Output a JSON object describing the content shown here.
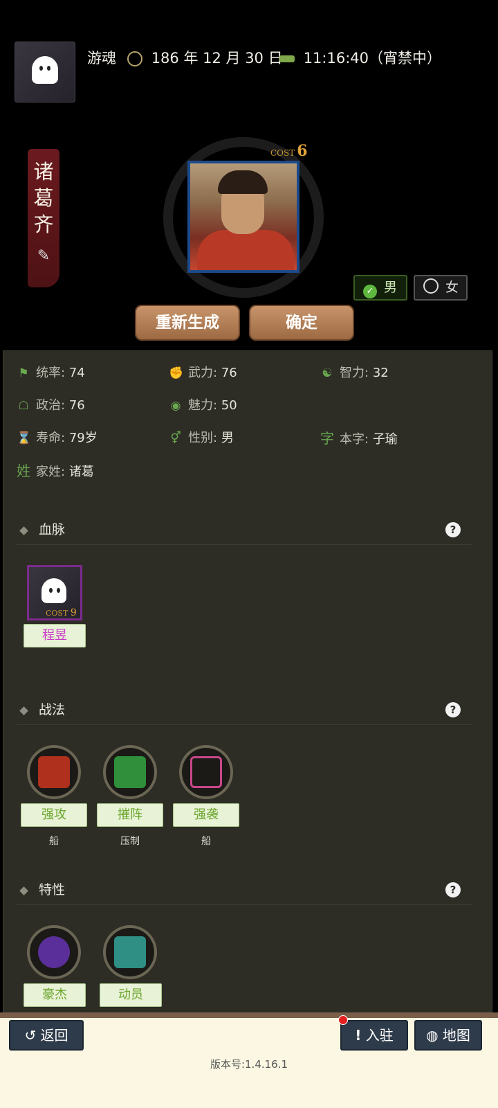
{
  "header": {
    "user": "游魂",
    "date": "186 年 12 月 30 日",
    "time": "11:16:40（宵禁中）"
  },
  "character": {
    "name_chars": [
      "诸",
      "葛",
      "齐"
    ],
    "cost_label": "COST",
    "cost": "6",
    "gender_options": {
      "male": "男",
      "female": "女",
      "selected": "男"
    },
    "regen_label": "重新生成",
    "confirm_label": "确定"
  },
  "stats": {
    "command": {
      "label": "统率:",
      "value": "74"
    },
    "force": {
      "label": "武力:",
      "value": "76"
    },
    "intel": {
      "label": "智力:",
      "value": "32"
    },
    "politics": {
      "label": "政治:",
      "value": "76"
    },
    "charm": {
      "label": "魅力:",
      "value": "50"
    },
    "lifespan": {
      "label": "寿命:",
      "value": "79岁"
    },
    "gender": {
      "label": "性别:",
      "value": "男"
    },
    "courtesy": {
      "icon": "字",
      "label": "本字:",
      "value": "子瑜"
    },
    "surname": {
      "icon": "姓",
      "label": "家姓:",
      "value": "诸葛"
    }
  },
  "sections": {
    "lineage": "血脉",
    "tactics": "战法",
    "traits": "特性",
    "help": "?"
  },
  "lineage": {
    "name": "程昱",
    "cost_label": "COST",
    "cost": "9"
  },
  "tactics": [
    {
      "name": "强攻",
      "sub": "船",
      "color": "#b0301e"
    },
    {
      "name": "摧阵",
      "sub": "压制",
      "color": "#2f8f3a"
    },
    {
      "name": "强袭",
      "sub": "船",
      "color": "#c8478a"
    }
  ],
  "traits": [
    {
      "name": "豪杰",
      "color": "#5a2f9a"
    },
    {
      "name": "动员",
      "color": "#2f8f85"
    }
  ],
  "footer": {
    "back_label": "返回",
    "station_label": "入驻",
    "map_label": "地图",
    "version": "版本号:1.4.16.1"
  }
}
